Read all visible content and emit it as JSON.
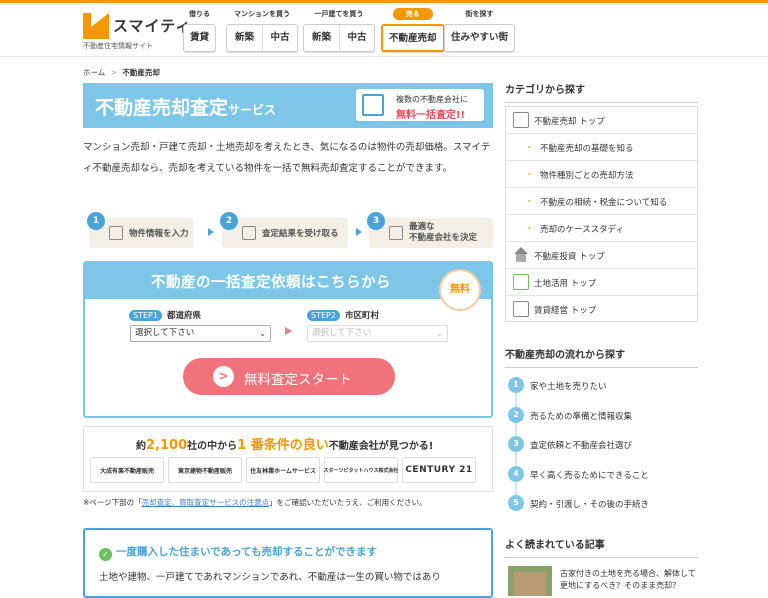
{
  "brand": {
    "name": "スマイティ",
    "tagline": "不動産住宅情報サイト",
    "accent": "#f39800"
  },
  "nav": [
    {
      "caption": "借りる",
      "buttons": [
        "賃貸"
      ],
      "active": false
    },
    {
      "caption": "マンションを買う",
      "buttons": [
        "新築",
        "中古"
      ],
      "active": false
    },
    {
      "caption": "一戸建てを買う",
      "buttons": [
        "新築",
        "中古"
      ],
      "active": false
    },
    {
      "caption": "売る",
      "buttons": [
        "不動産売却"
      ],
      "active": true
    },
    {
      "caption": "街を探す",
      "buttons": [
        "住みやすい街"
      ],
      "active": false
    }
  ],
  "breadcrumb": {
    "home": "ホーム",
    "sep": ">",
    "current": "不動産売却"
  },
  "hero": {
    "title": "不動産売却査定",
    "title_suffix": "サービス",
    "badge_line1": "複数の不動産会社に",
    "badge_line2": "無料一括査定!!"
  },
  "intro": "マンション売却・戸建て売却・土地売却を考えたとき、気になるのは物件の売却価格。スマイティ不動産売却なら、売却を考えている物件を一括で無料売却査定することができます。",
  "steps": [
    {
      "num": "1",
      "text": "物件情報を入力"
    },
    {
      "num": "2",
      "text": "査定結果を受け取る"
    },
    {
      "num": "3",
      "text_line1": "最適な",
      "text_line2": "不動産会社を決定"
    }
  ],
  "form": {
    "title": "不動産の一括査定依頼はこちらから",
    "free_badge": "無料",
    "step1_chip": "STEP1",
    "step1_label": "都道府県",
    "step1_value": "選択して下さい",
    "step2_chip": "STEP2",
    "step2_label": "市区町村",
    "step2_value": "選択して下さい",
    "start_label": "無料査定スタート",
    "start_icon": ">"
  },
  "companies": {
    "prefix": "約",
    "count": "2,100",
    "middle": "社の中から",
    "highlight": "1 番条件の良い",
    "suffix": "不動産会社が見つかる!",
    "logos": [
      "大成有楽不動産販売",
      "東京建物不動産販売",
      "住友林業ホームサービス",
      "スターツピタットハウス株式会社",
      "CENTURY 21"
    ]
  },
  "note": {
    "before": "※ページ下部の「",
    "link": "売却査定、買取査定サービスの注意点",
    "after": "」をご確認いただいたうえ、ご利用ください。"
  },
  "infobox": {
    "check_icon": "✓",
    "title": "一度購入した住まいであっても売却することができます",
    "text": "土地や建物、一戸建てであれマンションであれ、不動産は一生の買い物ではあり"
  },
  "sidebar": {
    "categories_title": "カテゴリから探す",
    "categories": [
      {
        "label": "不動産売却 トップ",
        "icon": "document-icon",
        "level": 0
      },
      {
        "label": "不動産売却の基礎を知る",
        "level": 1
      },
      {
        "label": "物件種別ごとの売却方法",
        "level": 1
      },
      {
        "label": "不動産の相続・税金について知る",
        "level": 1
      },
      {
        "label": "売却のケーススタディ",
        "level": 1
      },
      {
        "label": "不動産投資 トップ",
        "icon": "house-icon",
        "level": 0
      },
      {
        "label": "土地活用 トップ",
        "icon": "land-icon",
        "level": 0
      },
      {
        "label": "賃貸経営 トップ",
        "icon": "note-icon",
        "level": 0
      }
    ],
    "flow_title": "不動産売却の流れから探す",
    "flow": [
      {
        "num": "1",
        "label": "家や土地を売りたい"
      },
      {
        "num": "2",
        "label": "売るための準備と情報収集"
      },
      {
        "num": "3",
        "label": "査定依頼と不動産会社選び"
      },
      {
        "num": "4",
        "label": "早く高く売るためにできること"
      },
      {
        "num": "5",
        "label": "契約・引渡し・その後の手続き"
      }
    ],
    "popular_title": "よく読まれている記事",
    "popular": [
      {
        "text": "古家付きの土地を売る場合、解体して更地にするべき？そのまま売却？"
      }
    ]
  }
}
